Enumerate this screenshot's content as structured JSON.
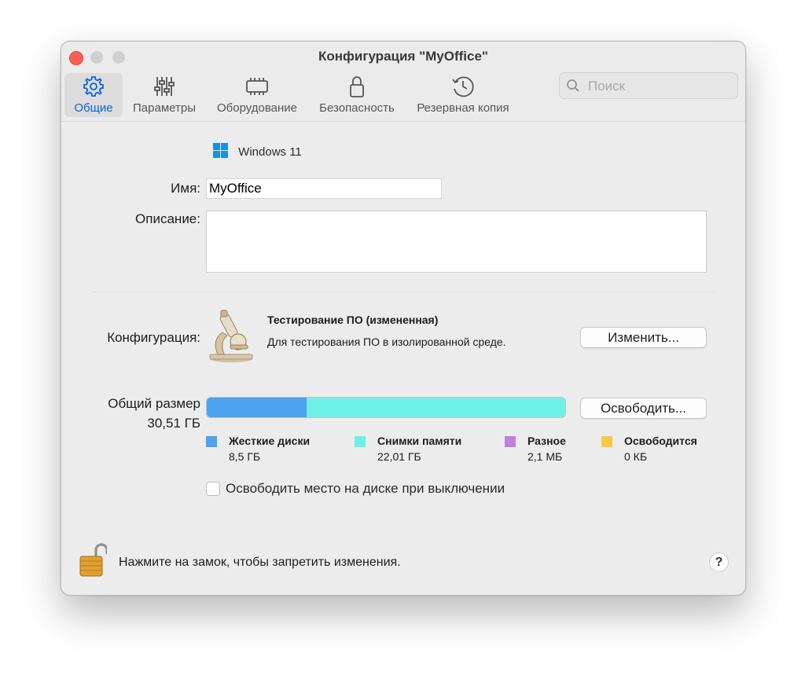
{
  "window": {
    "title": "Конфигурация \"MyOffice\""
  },
  "toolbar": {
    "tabs": [
      {
        "label": "Общие",
        "icon": "gear-icon",
        "active": true
      },
      {
        "label": "Параметры",
        "icon": "sliders-icon",
        "active": false
      },
      {
        "label": "Оборудование",
        "icon": "chip-icon",
        "active": false
      },
      {
        "label": "Безопасность",
        "icon": "lock-icon",
        "active": false
      },
      {
        "label": "Резервная копия",
        "icon": "history-icon",
        "active": false
      }
    ],
    "search_placeholder": "Поиск"
  },
  "general": {
    "os_name": "Windows 11",
    "name_label": "Имя:",
    "name_value": "MyOffice",
    "description_label": "Описание:",
    "description_value": ""
  },
  "configuration": {
    "label": "Конфигурация:",
    "profile_title": "Тестирование ПО (измененная)",
    "profile_desc": "Для тестирования ПО в изолированной среде.",
    "change_button": "Изменить..."
  },
  "storage": {
    "label": "Общий размер",
    "total": "30,51 ГБ",
    "free_button": "Освободить...",
    "bar_fractions": {
      "hard_disks": 0.279,
      "snapshots": 0.721,
      "misc": 0.0001,
      "reclaimable": 0.0
    },
    "legend": [
      {
        "name": "Жесткие диски",
        "value": "8,5 ГБ",
        "color": "#4ea3ee"
      },
      {
        "name": "Снимки памяти",
        "value": "22,01 ГБ",
        "color": "#6ef0e6"
      },
      {
        "name": "Разное",
        "value": "2,1 МБ",
        "color": "#c17fe0"
      },
      {
        "name": "Освободится",
        "value": "0 КБ",
        "color": "#f7c948"
      }
    ],
    "reclaim_checkbox_label": "Освободить место на диске при выключении",
    "reclaim_checked": false
  },
  "footer": {
    "lock_text": "Нажмите на замок, чтобы запретить изменения.",
    "help_label": "?"
  },
  "colors": {
    "accent": "#0a64d8",
    "close": "#ff5f57"
  }
}
